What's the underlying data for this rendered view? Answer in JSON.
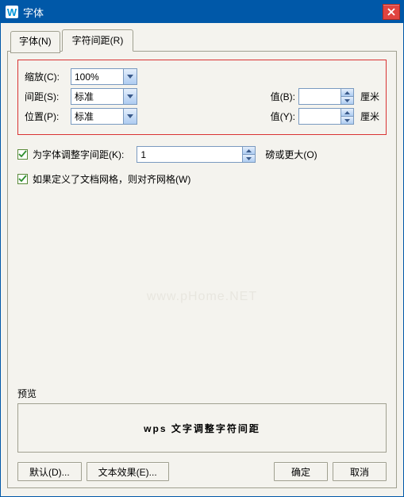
{
  "window": {
    "title": "字体"
  },
  "tabs": {
    "font": "字体(N)",
    "spacing": "字符间距(R)"
  },
  "fields": {
    "scale_label": "缩放(C):",
    "scale_value": "100%",
    "spacing_label": "间距(S):",
    "spacing_value": "标准",
    "value_b_label": "值(B):",
    "value_b": "",
    "unit_cm": "厘米",
    "position_label": "位置(P):",
    "position_value": "标准",
    "value_y_label": "值(Y):",
    "value_y": ""
  },
  "checks": {
    "kerning_label": "为字体调整字间距(K):",
    "kerning_value": "1",
    "kerning_unit": "磅或更大(O)",
    "snap_grid_label": "如果定义了文档网格，则对齐网格(W)"
  },
  "watermark": "www.pHome.NET",
  "preview": {
    "label": "预览",
    "text": "wps 文字调整字符间距"
  },
  "buttons": {
    "default": "默认(D)...",
    "text_effect": "文本效果(E)...",
    "ok": "确定",
    "cancel": "取消"
  }
}
